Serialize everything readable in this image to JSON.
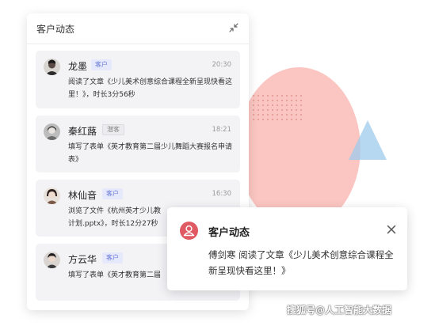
{
  "panel": {
    "title": "客户动态",
    "feed": [
      {
        "name": "龙墨",
        "tag": "客户",
        "time": "20:30",
        "description": "阅读了文章《少儿美术创意综合课程全新呈现快看这里！》，时长3分56秒"
      },
      {
        "name": "秦红蕗",
        "tag": "潜客",
        "time": "18:21",
        "description": "填写了表单《英才教育第二届少儿舞蹈大赛报名申请表》"
      },
      {
        "name": "林仙音",
        "tag": "客户",
        "time": "16:30",
        "description_line1": "浏览了文件《杭州英才少儿教",
        "description_line2": "计划.pptx》，时长12分27秒"
      },
      {
        "name": "方云华",
        "tag": "客户",
        "time": "",
        "description": "填写了表单《英才教育第二届"
      }
    ]
  },
  "popup": {
    "title": "客户动态",
    "body": "傅剑寒 阅读了文章《少儿美术创意综合课程全新呈现快看这里！》"
  },
  "watermark": "搜狐号@人工智能大数据",
  "icons": {
    "collapse": "collapse-arrows-icon",
    "close": "close-icon",
    "popup": "user-icon"
  },
  "colors": {
    "accent_red": "#e05a63",
    "tag_customer_bg": "#e6e9fb",
    "tag_customer_text": "#6b7bd6",
    "deco_circle": "#fbc6c2",
    "deco_triangle": "#9ecbec"
  }
}
